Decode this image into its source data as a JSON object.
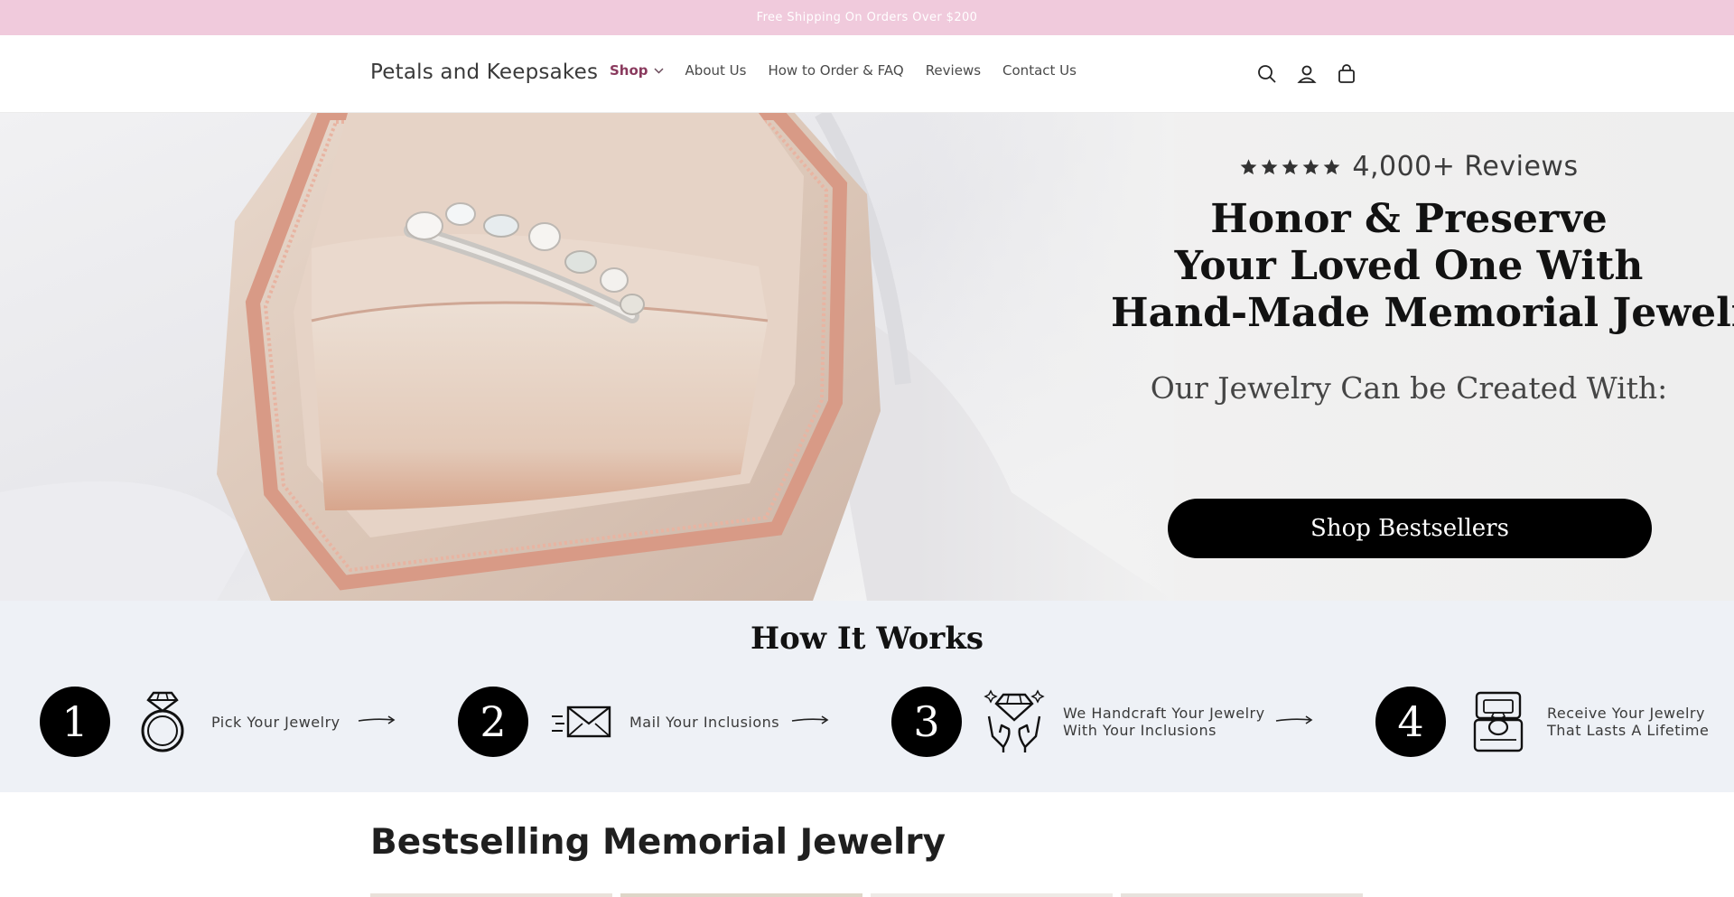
{
  "announcement": {
    "text": "Free Shipping On Orders Over $200"
  },
  "header": {
    "logo": "Petals and Keepsakes",
    "nav": [
      {
        "label": "Shop",
        "active": true,
        "has_dropdown": true
      },
      {
        "label": "About Us"
      },
      {
        "label": "How to Order & FAQ"
      },
      {
        "label": "Reviews"
      },
      {
        "label": "Contact Us"
      }
    ],
    "icons": [
      "search-icon",
      "account-icon",
      "cart-icon"
    ]
  },
  "hero": {
    "rating_stars": 5,
    "reviews_text": "4,000+ Reviews",
    "headline_lines": [
      "Honor & Preserve",
      "Your Loved One With",
      "Hand-Made Memorial Jewelry"
    ],
    "subline": "Our Jewelry Can be Created With:",
    "cta_label": "Shop Bestsellers",
    "image": "ring-in-velvet-box-photo"
  },
  "how_it_works": {
    "title": "How It Works",
    "steps": [
      {
        "number": "1",
        "icon": "ring-icon",
        "lines": [
          "Pick Your Jewelry"
        ]
      },
      {
        "number": "2",
        "icon": "envelope-icon",
        "lines": [
          "Mail Your Inclusions"
        ]
      },
      {
        "number": "3",
        "icon": "hands-diamond-icon",
        "lines": [
          "We Handcraft Your Jewelry",
          "With Your Inclusions"
        ]
      },
      {
        "number": "4",
        "icon": "ring-box-icon",
        "lines": [
          "Receive Your Jewelry",
          "That Lasts A Lifetime"
        ]
      }
    ]
  },
  "bestsellers": {
    "title": "Bestselling Memorial Jewelry"
  },
  "colors": {
    "announcement_bg": "#f0cadc",
    "nav_active": "#8a3a5e",
    "how_bg": "#eef1f6",
    "cta_bg": "#000000"
  }
}
